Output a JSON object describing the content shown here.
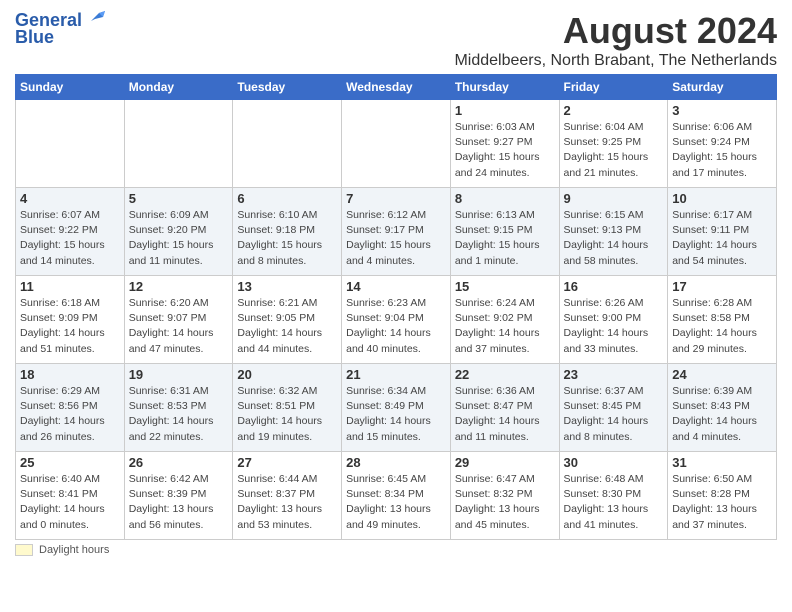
{
  "logo": {
    "line1": "General",
    "line2": "Blue"
  },
  "title": "August 2024",
  "subtitle": "Middelbeers, North Brabant, The Netherlands",
  "days_of_week": [
    "Sunday",
    "Monday",
    "Tuesday",
    "Wednesday",
    "Thursday",
    "Friday",
    "Saturday"
  ],
  "weeks": [
    [
      {
        "num": "",
        "info": ""
      },
      {
        "num": "",
        "info": ""
      },
      {
        "num": "",
        "info": ""
      },
      {
        "num": "",
        "info": ""
      },
      {
        "num": "1",
        "info": "Sunrise: 6:03 AM\nSunset: 9:27 PM\nDaylight: 15 hours and 24 minutes."
      },
      {
        "num": "2",
        "info": "Sunrise: 6:04 AM\nSunset: 9:25 PM\nDaylight: 15 hours and 21 minutes."
      },
      {
        "num": "3",
        "info": "Sunrise: 6:06 AM\nSunset: 9:24 PM\nDaylight: 15 hours and 17 minutes."
      }
    ],
    [
      {
        "num": "4",
        "info": "Sunrise: 6:07 AM\nSunset: 9:22 PM\nDaylight: 15 hours and 14 minutes."
      },
      {
        "num": "5",
        "info": "Sunrise: 6:09 AM\nSunset: 9:20 PM\nDaylight: 15 hours and 11 minutes."
      },
      {
        "num": "6",
        "info": "Sunrise: 6:10 AM\nSunset: 9:18 PM\nDaylight: 15 hours and 8 minutes."
      },
      {
        "num": "7",
        "info": "Sunrise: 6:12 AM\nSunset: 9:17 PM\nDaylight: 15 hours and 4 minutes."
      },
      {
        "num": "8",
        "info": "Sunrise: 6:13 AM\nSunset: 9:15 PM\nDaylight: 15 hours and 1 minute."
      },
      {
        "num": "9",
        "info": "Sunrise: 6:15 AM\nSunset: 9:13 PM\nDaylight: 14 hours and 58 minutes."
      },
      {
        "num": "10",
        "info": "Sunrise: 6:17 AM\nSunset: 9:11 PM\nDaylight: 14 hours and 54 minutes."
      }
    ],
    [
      {
        "num": "11",
        "info": "Sunrise: 6:18 AM\nSunset: 9:09 PM\nDaylight: 14 hours and 51 minutes."
      },
      {
        "num": "12",
        "info": "Sunrise: 6:20 AM\nSunset: 9:07 PM\nDaylight: 14 hours and 47 minutes."
      },
      {
        "num": "13",
        "info": "Sunrise: 6:21 AM\nSunset: 9:05 PM\nDaylight: 14 hours and 44 minutes."
      },
      {
        "num": "14",
        "info": "Sunrise: 6:23 AM\nSunset: 9:04 PM\nDaylight: 14 hours and 40 minutes."
      },
      {
        "num": "15",
        "info": "Sunrise: 6:24 AM\nSunset: 9:02 PM\nDaylight: 14 hours and 37 minutes."
      },
      {
        "num": "16",
        "info": "Sunrise: 6:26 AM\nSunset: 9:00 PM\nDaylight: 14 hours and 33 minutes."
      },
      {
        "num": "17",
        "info": "Sunrise: 6:28 AM\nSunset: 8:58 PM\nDaylight: 14 hours and 29 minutes."
      }
    ],
    [
      {
        "num": "18",
        "info": "Sunrise: 6:29 AM\nSunset: 8:56 PM\nDaylight: 14 hours and 26 minutes."
      },
      {
        "num": "19",
        "info": "Sunrise: 6:31 AM\nSunset: 8:53 PM\nDaylight: 14 hours and 22 minutes."
      },
      {
        "num": "20",
        "info": "Sunrise: 6:32 AM\nSunset: 8:51 PM\nDaylight: 14 hours and 19 minutes."
      },
      {
        "num": "21",
        "info": "Sunrise: 6:34 AM\nSunset: 8:49 PM\nDaylight: 14 hours and 15 minutes."
      },
      {
        "num": "22",
        "info": "Sunrise: 6:36 AM\nSunset: 8:47 PM\nDaylight: 14 hours and 11 minutes."
      },
      {
        "num": "23",
        "info": "Sunrise: 6:37 AM\nSunset: 8:45 PM\nDaylight: 14 hours and 8 minutes."
      },
      {
        "num": "24",
        "info": "Sunrise: 6:39 AM\nSunset: 8:43 PM\nDaylight: 14 hours and 4 minutes."
      }
    ],
    [
      {
        "num": "25",
        "info": "Sunrise: 6:40 AM\nSunset: 8:41 PM\nDaylight: 14 hours and 0 minutes."
      },
      {
        "num": "26",
        "info": "Sunrise: 6:42 AM\nSunset: 8:39 PM\nDaylight: 13 hours and 56 minutes."
      },
      {
        "num": "27",
        "info": "Sunrise: 6:44 AM\nSunset: 8:37 PM\nDaylight: 13 hours and 53 minutes."
      },
      {
        "num": "28",
        "info": "Sunrise: 6:45 AM\nSunset: 8:34 PM\nDaylight: 13 hours and 49 minutes."
      },
      {
        "num": "29",
        "info": "Sunrise: 6:47 AM\nSunset: 8:32 PM\nDaylight: 13 hours and 45 minutes."
      },
      {
        "num": "30",
        "info": "Sunrise: 6:48 AM\nSunset: 8:30 PM\nDaylight: 13 hours and 41 minutes."
      },
      {
        "num": "31",
        "info": "Sunrise: 6:50 AM\nSunset: 8:28 PM\nDaylight: 13 hours and 37 minutes."
      }
    ]
  ],
  "footer": {
    "note": "Daylight hours"
  }
}
